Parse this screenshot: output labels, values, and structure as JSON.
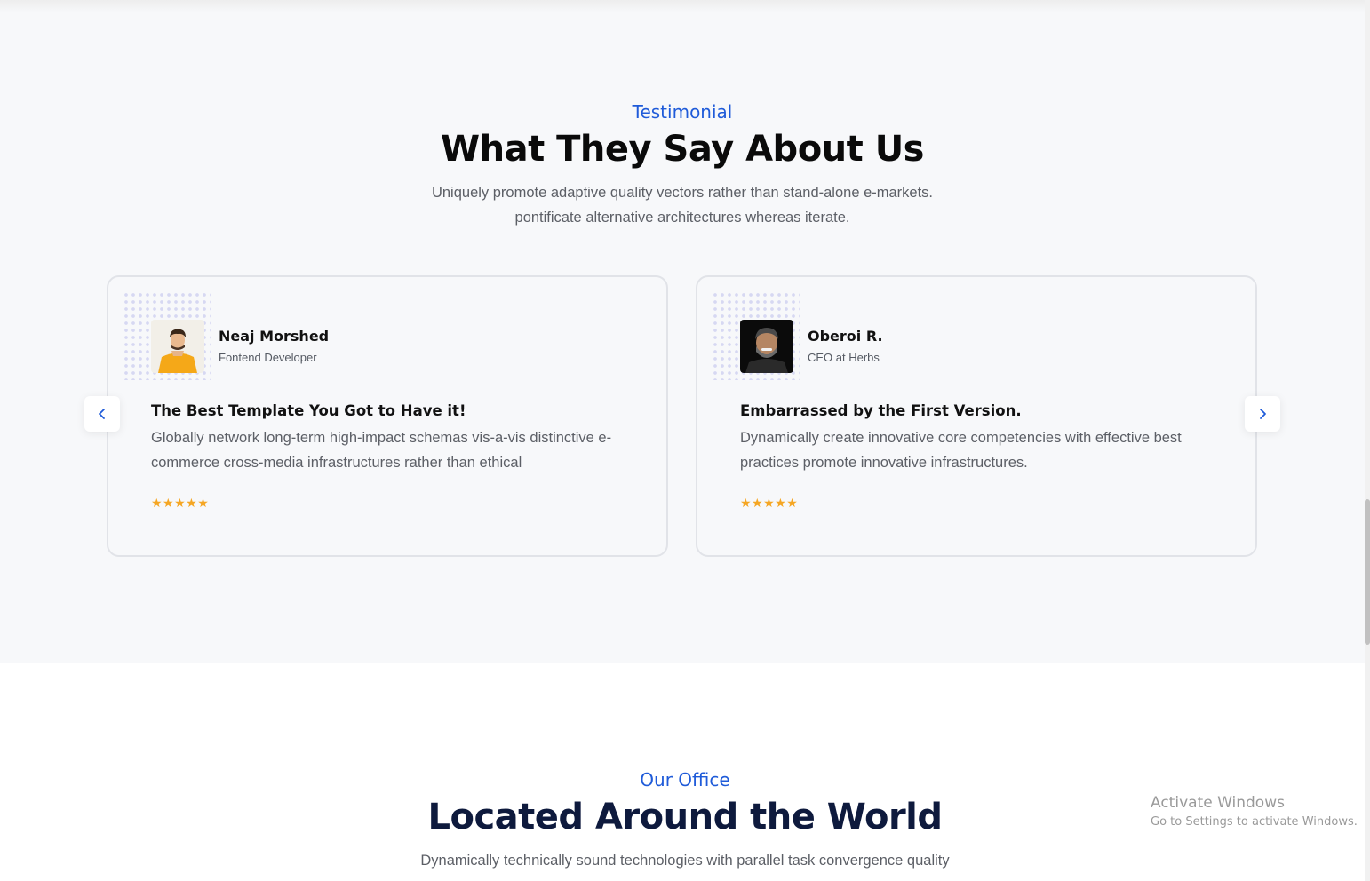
{
  "testimonial": {
    "kicker": "Testimonial",
    "title": "What They Say About Us",
    "desc_line1": "Uniquely promote adaptive quality vectors rather than stand-alone e-markets.",
    "desc_line2": "pontificate alternative architectures whereas iterate."
  },
  "testimonials": [
    {
      "name": "Neaj Morshed",
      "role": "Fontend Developer",
      "title": "The Best Template You Got to Have it!",
      "text": "Globally network long-term high-impact schemas vis-a-vis distinctive e-commerce cross-media infrastructures rather than ethical",
      "stars": "★★★★★",
      "rating": 5
    },
    {
      "name": "Oberoi R.",
      "role": "CEO at Herbs",
      "title": "Embarrassed by the First Version.",
      "text": "Dynamically create innovative core competencies with effective best practices promote innovative infrastructures.",
      "stars": "★★★★★",
      "rating": 5
    }
  ],
  "office": {
    "kicker": "Our Office",
    "title": "Located Around the World",
    "desc": "Dynamically technically sound technologies with parallel task convergence quality"
  },
  "watermark": {
    "line1": "Activate Windows",
    "line2": "Go to Settings to activate Windows."
  },
  "colors": {
    "accent": "#1f5bd9",
    "star": "#f5a623",
    "section_bg": "#f7f8fa",
    "heading_dark": "#0e1a3d"
  }
}
